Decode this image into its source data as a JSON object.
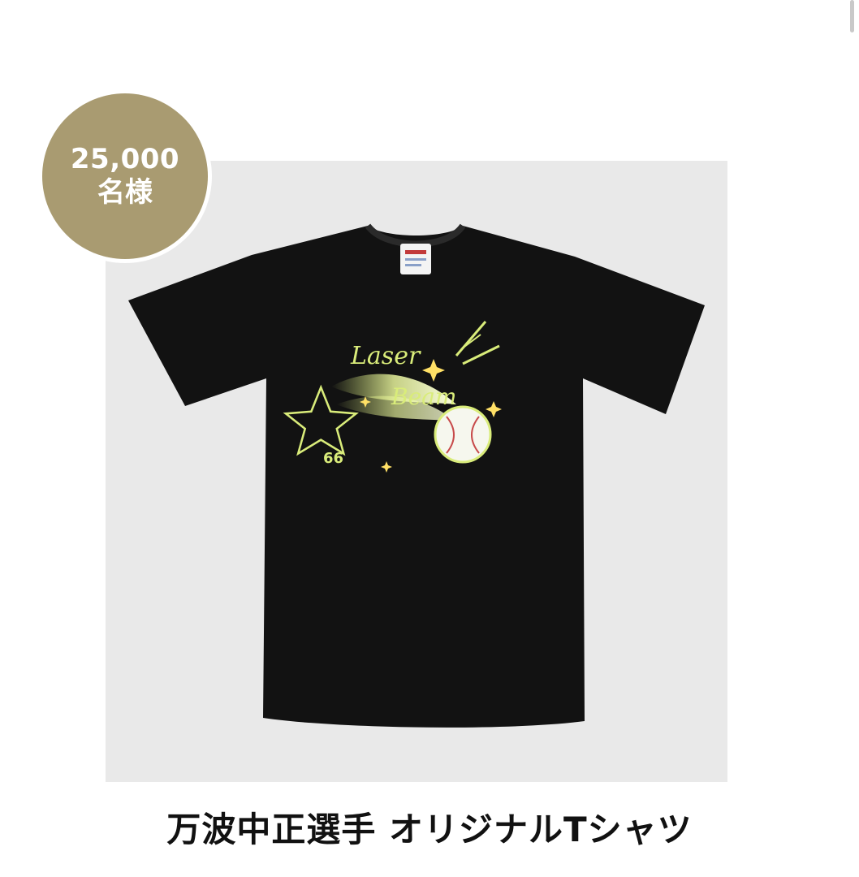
{
  "badge": {
    "count": "25,000",
    "unit": "名様",
    "color": "#a99b71"
  },
  "product": {
    "title": "万波中正選手 オリジナルTシャツ",
    "image": {
      "print_text_line1": "Laser",
      "print_text_line2": "Beam",
      "print_number": "66",
      "shirt_color": "#121212",
      "print_color": "#d9ec7a"
    }
  },
  "colors": {
    "panel_background": "#e9e9e9",
    "page_background": "#ffffff"
  }
}
